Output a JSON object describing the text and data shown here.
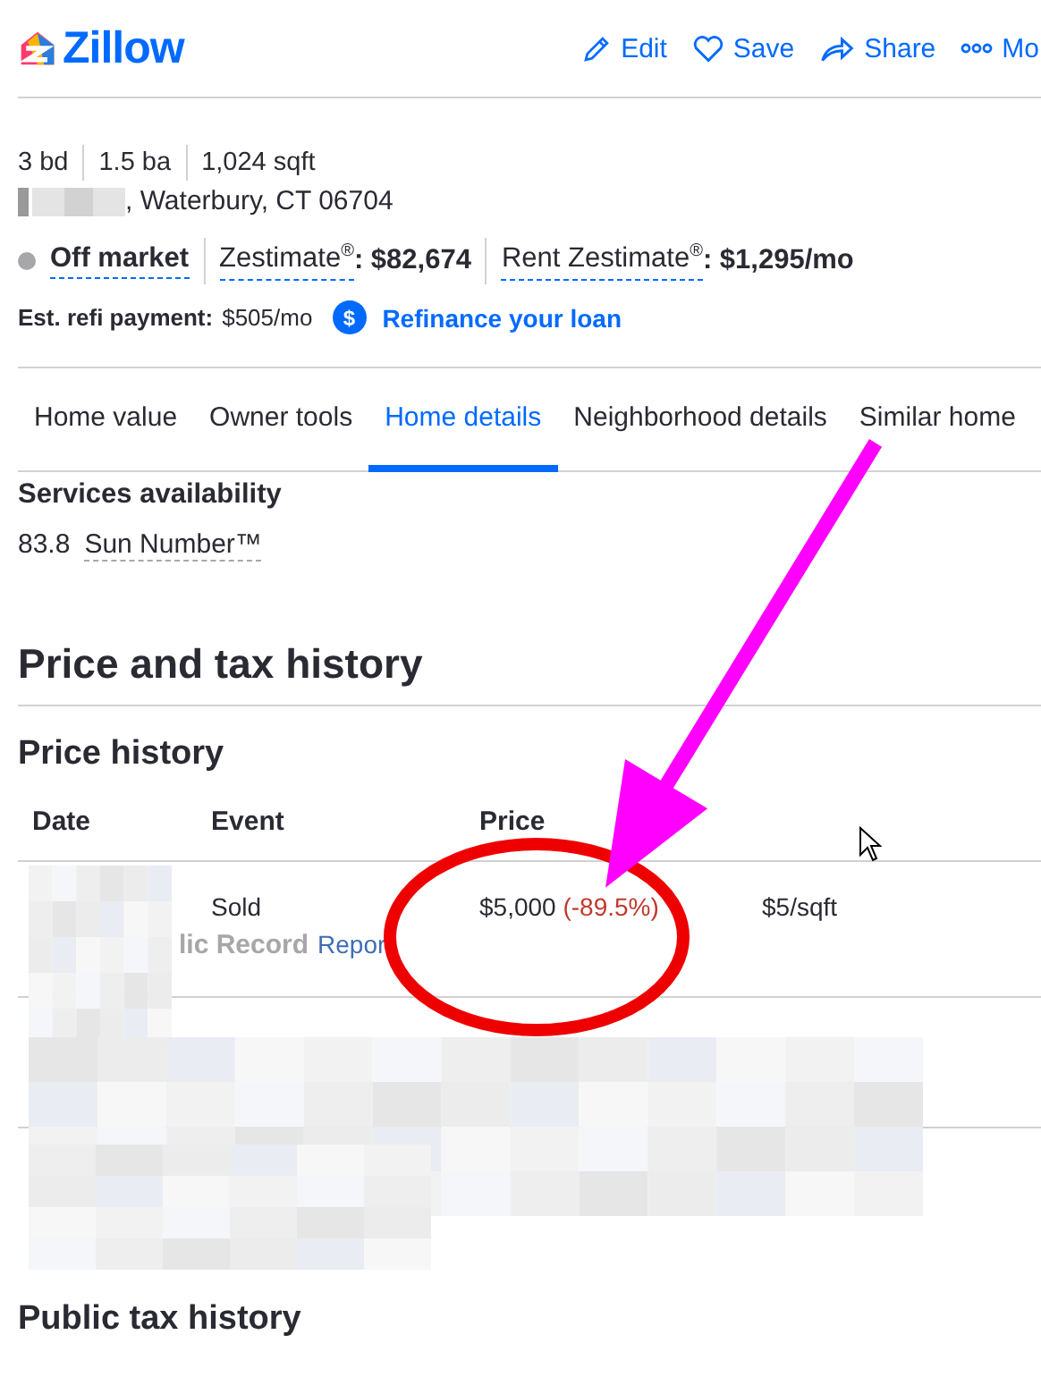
{
  "header": {
    "logo": "Zillow",
    "actions": [
      {
        "kind": "edit",
        "label": "Edit"
      },
      {
        "kind": "save",
        "label": "Save"
      },
      {
        "kind": "share",
        "label": "Share"
      },
      {
        "kind": "more",
        "label": "Mo"
      }
    ]
  },
  "facts": [
    "3 bd",
    "1.5 ba",
    "1,024 sqft"
  ],
  "address": ", Waterbury, CT 06704",
  "status": {
    "label": "Off market",
    "zestimate_label": "Zestimate",
    "zestimate_mark": "®",
    "zestimate_value": ": $82,674",
    "rent_label": "Rent Zestimate",
    "rent_mark": "®",
    "rent_value": ": $1,295/mo"
  },
  "refi": {
    "label": "Est. refi payment:",
    "value": "$505/mo",
    "icon": "$",
    "link": "Refinance your loan"
  },
  "tabs": [
    {
      "label": "Home value",
      "selected": false
    },
    {
      "label": "Owner tools",
      "selected": false
    },
    {
      "label": "Home details",
      "selected": true
    },
    {
      "label": "Neighborhood details",
      "selected": false
    },
    {
      "label": "Similar home",
      "selected": false
    }
  ],
  "services": {
    "title": "Services availability",
    "score": "83.8",
    "name": "Sun Number™"
  },
  "section_title": "Price and tax history",
  "price_history": {
    "title": "Price history",
    "columns": [
      "Date",
      "Event",
      "Price"
    ],
    "rows": [
      {
        "event": "Sold",
        "price": "$5,000",
        "change": "(-89.5%)",
        "per_sqft": "$5/sqft",
        "source": "lic Record",
        "source_link": "Repor"
      }
    ]
  },
  "tax_title": "Public tax history"
}
